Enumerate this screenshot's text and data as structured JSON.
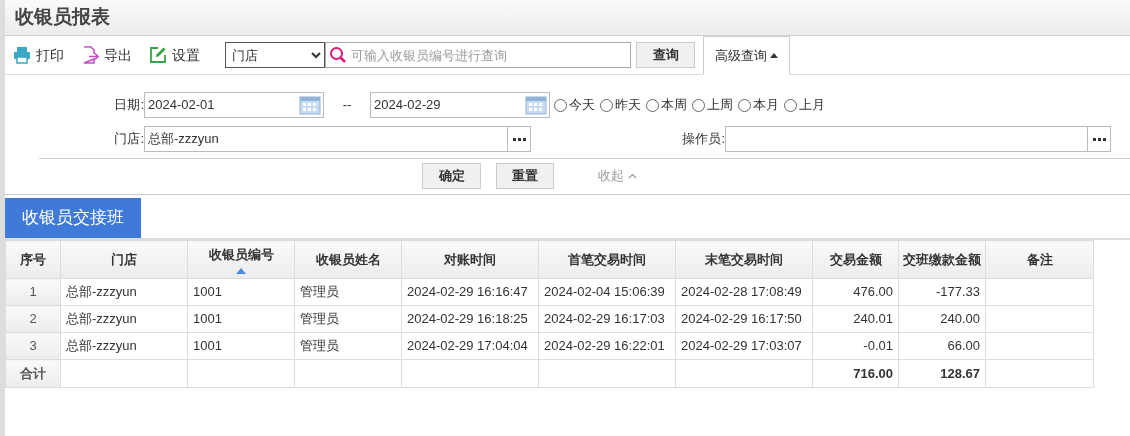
{
  "window": {
    "title": "收银员报表"
  },
  "toolbar": {
    "actions": [
      {
        "kind": "print",
        "label": "打印"
      },
      {
        "kind": "export",
        "label": "导出"
      },
      {
        "kind": "settings",
        "label": "设置"
      }
    ],
    "scope_select": {
      "value": "门店"
    },
    "search": {
      "placeholder": "可输入收银员编号进行查询"
    },
    "query_button": "查询",
    "advanced_tab": {
      "label": "高级查询",
      "expanded": true
    }
  },
  "filters": {
    "date_label": "日期:",
    "date_from": "2024-02-01",
    "date_sep": "--",
    "date_to": "2024-02-29",
    "ranges": [
      {
        "label": "今天",
        "selected": false
      },
      {
        "label": "昨天",
        "selected": false
      },
      {
        "label": "本周",
        "selected": false
      },
      {
        "label": "上周",
        "selected": false
      },
      {
        "label": "本月",
        "selected": false
      },
      {
        "label": "上月",
        "selected": false
      }
    ],
    "store_label": "门店:",
    "store_value": "总部-zzzyun",
    "operator_label": "操作员:",
    "confirm_button": "确定",
    "reset_button": "重置",
    "collapse_link": "收起"
  },
  "section_tab": "收银员交接班",
  "table": {
    "columns": [
      {
        "label": "序号"
      },
      {
        "label": "门店"
      },
      {
        "label": "收银员编号",
        "sorted": true
      },
      {
        "label": "收银员姓名"
      },
      {
        "label": "对账时间"
      },
      {
        "label": "首笔交易时间"
      },
      {
        "label": "末笔交易时间"
      },
      {
        "label": "交易金额"
      },
      {
        "label": "交班缴款金额"
      },
      {
        "label": "备注"
      }
    ],
    "rows": [
      [
        "1",
        "总部-zzzyun",
        "1001",
        "管理员",
        "2024-02-29 16:16:47",
        "2024-02-04 15:06:39",
        "2024-02-28 17:08:49",
        "476.00",
        "-177.33"
      ],
      [
        "2",
        "总部-zzzyun",
        "1001",
        "管理员",
        "2024-02-29 16:18:25",
        "2024-02-29 16:17:03",
        "2024-02-29 16:17:50",
        "240.01",
        "240.00"
      ],
      [
        "3",
        "总部-zzzyun",
        "1001",
        "管理员",
        "2024-02-29 17:04:04",
        "2024-02-29 16:22:01",
        "2024-02-29 17:03:07",
        "-0.01",
        "66.00"
      ]
    ],
    "total": {
      "label": "合计",
      "amount": "716.00",
      "payment": "128.67"
    }
  }
}
